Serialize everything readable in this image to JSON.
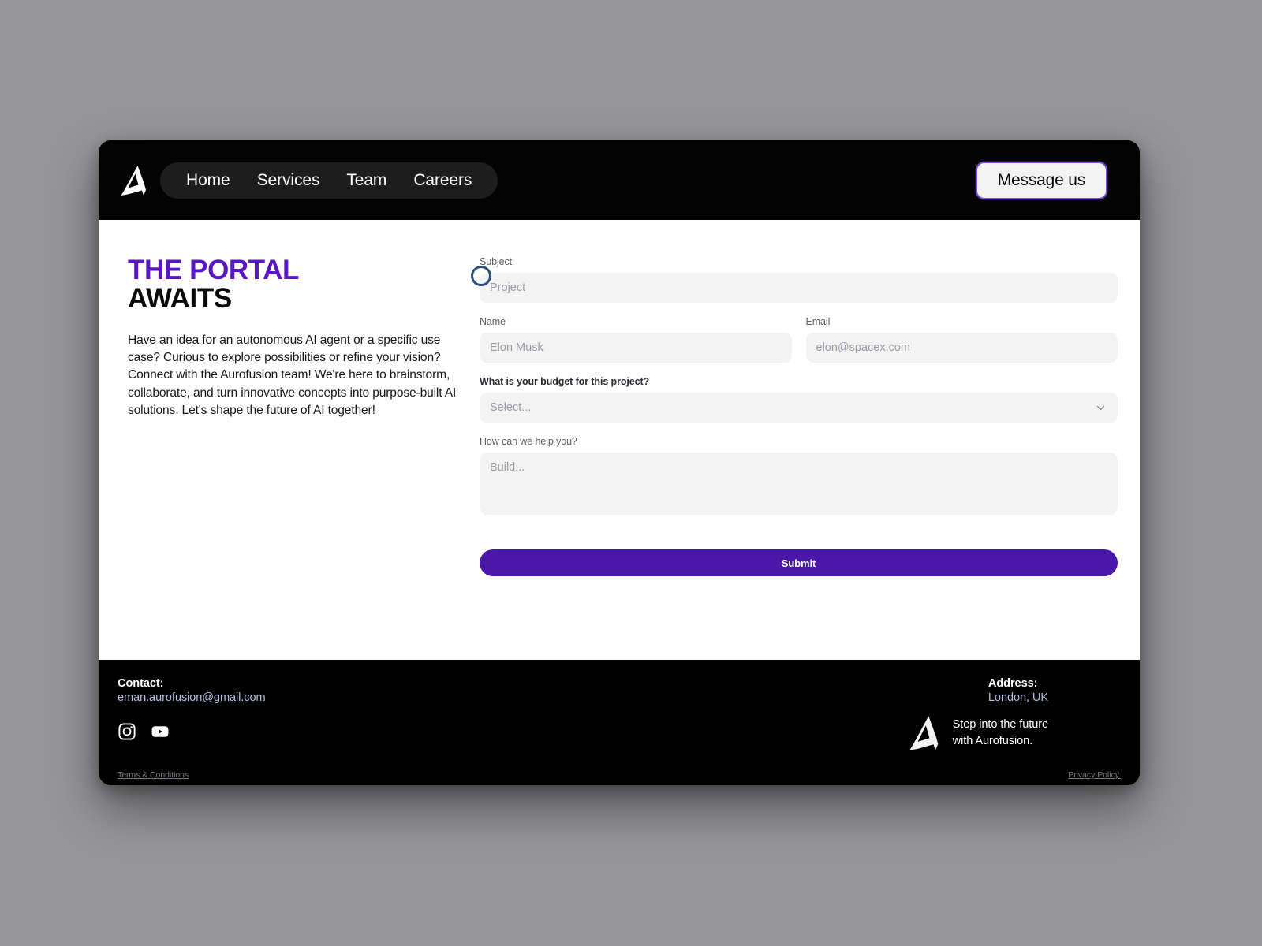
{
  "navbar": {
    "logo_alt": "Aurofusion logo",
    "links": [
      {
        "label": "Home"
      },
      {
        "label": "Services"
      },
      {
        "label": "Team"
      },
      {
        "label": "Careers"
      }
    ],
    "cta_label": "Message us",
    "accent_border_color": "#7c4dd8",
    "background_color": "#030303"
  },
  "hero": {
    "title_line_1": "THE PORTAL",
    "title_line_2": "AWAITS",
    "title_accent_color": "#5b16c4",
    "paragraph": "Have an idea for an autonomous AI agent or a specific use case? Curious to explore possibilities or refine your vision? Connect with the Aurofusion team! We're here to brainstorm, collaborate, and turn innovative concepts into purpose-built AI solutions. Let's shape the future of AI together!",
    "ring_indicator_color": "#2d4e80"
  },
  "form": {
    "subject": {
      "label": "Subject",
      "placeholder": "Project",
      "value": ""
    },
    "name": {
      "label": "Name",
      "placeholder": "Elon Musk",
      "value": ""
    },
    "email": {
      "label": "Email",
      "placeholder": "elon@spacex.com",
      "value": ""
    },
    "budget": {
      "label": "What is your budget for this project?",
      "selected": "Select...",
      "options": [
        "Select..."
      ]
    },
    "message": {
      "label": "How can we help you?",
      "placeholder": "Build...",
      "value": ""
    },
    "submit_label": "Submit",
    "submit_color": "#4a17a8"
  },
  "footer": {
    "contact_heading": "Contact:",
    "contact_email": "eman.aurofusion@gmail.com",
    "address_heading": "Address:",
    "address_value": "London, UK",
    "tagline_line_1": "Step into the future",
    "tagline_line_2": "with Aurofusion.",
    "social": [
      {
        "name": "instagram"
      },
      {
        "name": "youtube"
      }
    ],
    "legal_left": "Terms & Conditions",
    "legal_right": "Privacy Policy.",
    "link_color": "#b7bce2"
  }
}
